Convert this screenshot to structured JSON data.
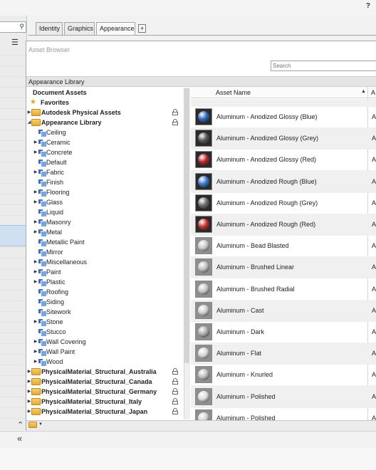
{
  "app": {
    "help_label": "?"
  },
  "left_panel": {
    "search_icon": "magnifier-icon",
    "list_icon": "list-view-icon"
  },
  "tabs": [
    {
      "label": "Identity",
      "active": false
    },
    {
      "label": "Graphics",
      "active": false
    },
    {
      "label": "Appearance",
      "active": true
    }
  ],
  "add_tab_label": "+",
  "browser": {
    "title": "Asset Browser",
    "search_placeholder": "Search",
    "library_header": "Appearance Library",
    "list_columns": {
      "name": "Asset Name",
      "type": "A"
    },
    "sort_indicator": "▲"
  },
  "tree": [
    {
      "label": "Document Assets",
      "bold": true,
      "indent": 0,
      "icon": "none"
    },
    {
      "label": "Favorites",
      "bold": true,
      "indent": 0,
      "icon": "star-icon"
    },
    {
      "label": "Autodesk Physical Assets",
      "bold": true,
      "indent": 0,
      "icon": "folder-icon",
      "expand": "collapsed",
      "locked": true
    },
    {
      "label": "Appearance Library",
      "bold": true,
      "indent": 0,
      "icon": "folder-icon",
      "expand": "expanded",
      "locked": true
    },
    {
      "label": "Ceiling",
      "indent": 1,
      "icon": "category-icon"
    },
    {
      "label": "Ceramic",
      "indent": 1,
      "icon": "category-icon",
      "expand": "collapsed"
    },
    {
      "label": "Concrete",
      "indent": 1,
      "icon": "category-icon",
      "expand": "collapsed"
    },
    {
      "label": "Default",
      "indent": 1,
      "icon": "category-icon"
    },
    {
      "label": "Fabric",
      "indent": 1,
      "icon": "category-icon",
      "expand": "collapsed"
    },
    {
      "label": "Finish",
      "indent": 1,
      "icon": "category-icon"
    },
    {
      "label": "Flooring",
      "indent": 1,
      "icon": "category-icon",
      "expand": "collapsed"
    },
    {
      "label": "Glass",
      "indent": 1,
      "icon": "category-icon",
      "expand": "collapsed"
    },
    {
      "label": "Liquid",
      "indent": 1,
      "icon": "category-icon"
    },
    {
      "label": "Masonry",
      "indent": 1,
      "icon": "category-icon",
      "expand": "collapsed"
    },
    {
      "label": "Metal",
      "indent": 1,
      "icon": "category-icon",
      "expand": "collapsed"
    },
    {
      "label": "Metallic Paint",
      "indent": 1,
      "icon": "category-icon"
    },
    {
      "label": "Mirror",
      "indent": 1,
      "icon": "category-icon"
    },
    {
      "label": "Miscellaneous",
      "indent": 1,
      "icon": "category-icon",
      "expand": "collapsed"
    },
    {
      "label": "Paint",
      "indent": 1,
      "icon": "category-icon",
      "expand": "collapsed"
    },
    {
      "label": "Plastic",
      "indent": 1,
      "icon": "category-icon",
      "expand": "collapsed"
    },
    {
      "label": "Roofing",
      "indent": 1,
      "icon": "category-icon"
    },
    {
      "label": "Siding",
      "indent": 1,
      "icon": "category-icon"
    },
    {
      "label": "Sitework",
      "indent": 1,
      "icon": "category-icon"
    },
    {
      "label": "Stone",
      "indent": 1,
      "icon": "category-icon",
      "expand": "collapsed"
    },
    {
      "label": "Stucco",
      "indent": 1,
      "icon": "category-icon"
    },
    {
      "label": "Wall Covering",
      "indent": 1,
      "icon": "category-icon",
      "expand": "collapsed"
    },
    {
      "label": "Wall Paint",
      "indent": 1,
      "icon": "category-icon",
      "expand": "collapsed"
    },
    {
      "label": "Wood",
      "indent": 1,
      "icon": "category-icon",
      "expand": "collapsed"
    },
    {
      "label": "PhysicalMaterial_Structural_Australia",
      "bold": true,
      "indent": 0,
      "icon": "folder-icon",
      "expand": "collapsed",
      "locked": true
    },
    {
      "label": "PhysicalMaterial_Structural_Canada",
      "bold": true,
      "indent": 0,
      "icon": "folder-icon",
      "expand": "collapsed",
      "locked": true
    },
    {
      "label": "PhysicalMaterial_Structural_Germany",
      "bold": true,
      "indent": 0,
      "icon": "folder-icon",
      "expand": "collapsed",
      "locked": true
    },
    {
      "label": "PhysicalMaterial_Structural_Italy",
      "bold": true,
      "indent": 0,
      "icon": "folder-icon",
      "expand": "collapsed",
      "locked": true
    },
    {
      "label": "PhysicalMaterial_Structural_Japan",
      "bold": true,
      "indent": 0,
      "icon": "folder-icon",
      "expand": "collapsed",
      "locked": true
    }
  ],
  "assets": [
    {
      "name": "Aluminum - Anodized Glossy (Blue)",
      "type": "A",
      "color": "#2f64b8"
    },
    {
      "name": "Aluminum - Anodized Glossy (Grey)",
      "type": "A",
      "color": "#555555"
    },
    {
      "name": "Aluminum - Anodized Glossy (Red)",
      "type": "A",
      "color": "#b3262a"
    },
    {
      "name": "Aluminum - Anodized Rough (Blue)",
      "type": "A",
      "color": "#3a77c7"
    },
    {
      "name": "Aluminum - Anodized Rough (Grey)",
      "type": "A",
      "color": "#6b6b6b"
    },
    {
      "name": "Aluminum - Anodized Rough (Red)",
      "type": "A",
      "color": "#c0302c"
    },
    {
      "name": "Aluminum - Bead Blasted",
      "type": "A",
      "color": "#c9c9c9"
    },
    {
      "name": "Aluminum - Brushed Linear",
      "type": "A",
      "color": "#bdbdbd"
    },
    {
      "name": "Aluminum - Brushed Radial",
      "type": "A",
      "color": "#c4c4c4"
    },
    {
      "name": "Aluminum - Cast",
      "type": "A",
      "color": "#cfcfcf"
    },
    {
      "name": "Aluminum - Dark",
      "type": "A",
      "color": "#a9a9a9"
    },
    {
      "name": "Aluminum - Flat",
      "type": "A",
      "color": "#d6d6d6"
    },
    {
      "name": "Aluminum - Knurled",
      "type": "A",
      "color": "#bcbcbc"
    },
    {
      "name": "Aluminum - Polished",
      "type": "A",
      "color": "#dcdcdc"
    },
    {
      "name": "Aluminum - Polished",
      "type": "A",
      "color": "#d2d2d2"
    }
  ],
  "bottom": {
    "up_icon": "collapse-up-icon",
    "library_icon": "library-folder-icon",
    "collapse_icon": "collapse-left-icon"
  }
}
